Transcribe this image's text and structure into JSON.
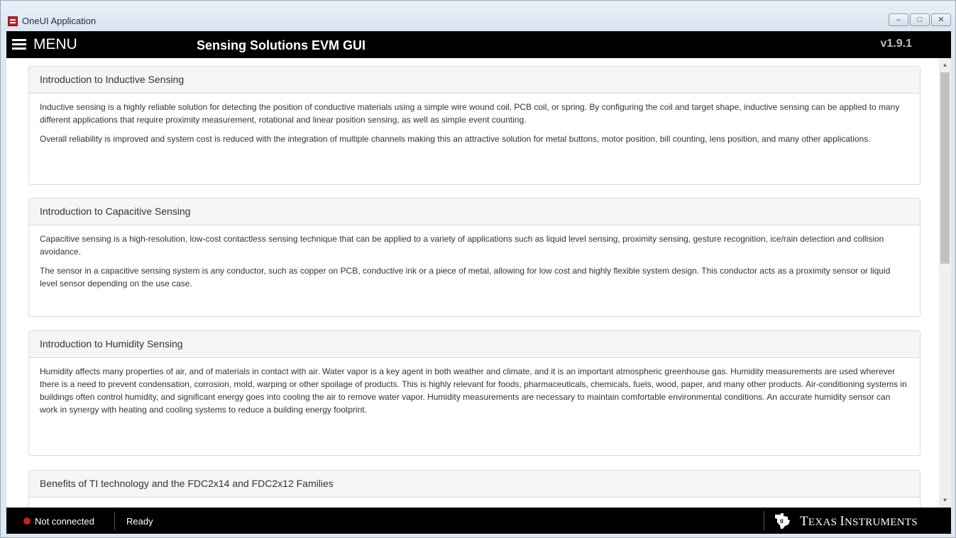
{
  "window": {
    "title": "OneUI Application",
    "controls": [
      "minimize",
      "maximize",
      "close"
    ]
  },
  "header": {
    "menu_label": "MENU",
    "app_title": "Sensing Solutions EVM GUI",
    "version": "v1.9.1"
  },
  "panels": [
    {
      "title": "Introduction to Inductive Sensing",
      "paragraphs": [
        "Inductive sensing is a highly reliable solution for detecting the position of conductive materials using a simple wire wound coil, PCB coil, or spring. By configuring the coil and target shape, inductive sensing can be applied to many different applications that require proximity measurement, rotational and linear position sensing, as well as simple event counting.",
        "Overall reliability is improved and system cost is reduced with the integration of multiple channels making this an attractive solution for metal buttons, motor position, bill counting, lens position, and many other applications."
      ]
    },
    {
      "title": "Introduction to Capacitive Sensing",
      "paragraphs": [
        "Capacitive sensing is a high-resolution, low-cost contactless sensing technique that can be applied to a variety of applications such as liquid level sensing, proximity sensing, gesture recognition, ice/rain detection and collision avoidance.",
        "The sensor in a capacitive sensing system is any conductor, such as copper on PCB, conductive ink or a piece of metal, allowing for low cost and highly flexible system design. This conductor acts as a proximity sensor or liquid level sensor depending on the use case."
      ]
    },
    {
      "title": "Introduction to Humidity Sensing",
      "paragraphs": [
        "Humidity affects many properties of air, and of materials in contact with air. Water vapor is a key agent in both weather and climate, and it is an important atmospheric greenhouse gas. Humidity measurements are used wherever there is a need to prevent condensation, corrosion, mold, warping or other spoilage of products. This is highly relevant for foods, pharmaceuticals, chemicals, fuels, wood, paper, and many other products. Air-conditioning systems in buildings often control humidity, and significant energy goes into cooling the air to remove water vapor. Humidity measurements are necessary to maintain comfortable environmental conditions. An accurate humidity sensor can work in synergy with heating and cooling systems to reduce a building energy footprint."
      ]
    },
    {
      "title": "Benefits of TI technology and the FDC2x14 and FDC2x12 Families",
      "paragraphs": []
    }
  ],
  "status": {
    "connection": "Not connected",
    "connection_color": "#cc1f1a",
    "state": "Ready",
    "brand": "Texas Instruments",
    "brand_first": "T",
    "brand_rest1": "EXAS ",
    "brand_second": "I",
    "brand_rest2": "NSTRUMENTS"
  }
}
